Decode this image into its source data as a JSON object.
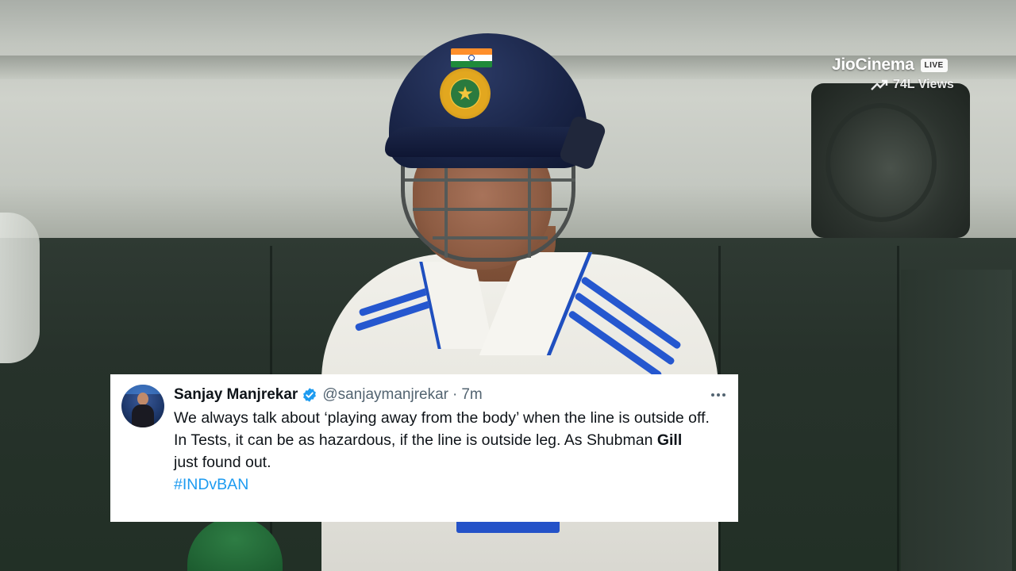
{
  "broadcast": {
    "brand": "JioCinema",
    "live_label": "LIVE",
    "views": "74L Views",
    "icons": [
      "trend-up-icon"
    ]
  },
  "tweet": {
    "author": "Sanjay Manjrekar",
    "handle": "@sanjaymanjrekar",
    "separator": "·",
    "time": "7m",
    "verified": true,
    "line1": "We always talk about ‘playing away from the body’ when the line is outside off.",
    "line2_prefix": "In Tests, it can be as hazardous, if the line is outside leg. As Shubman ",
    "line2_bold": "Gill",
    "line2_suffix": "just found out.",
    "hashtag": "#INDvBAN",
    "icons": [
      "verified-badge-icon",
      "more-options-icon"
    ],
    "colors": {
      "link": "#1d9bf0",
      "verified": "#1d9bf0",
      "text": "#0f1419",
      "muted": "#536471"
    }
  }
}
